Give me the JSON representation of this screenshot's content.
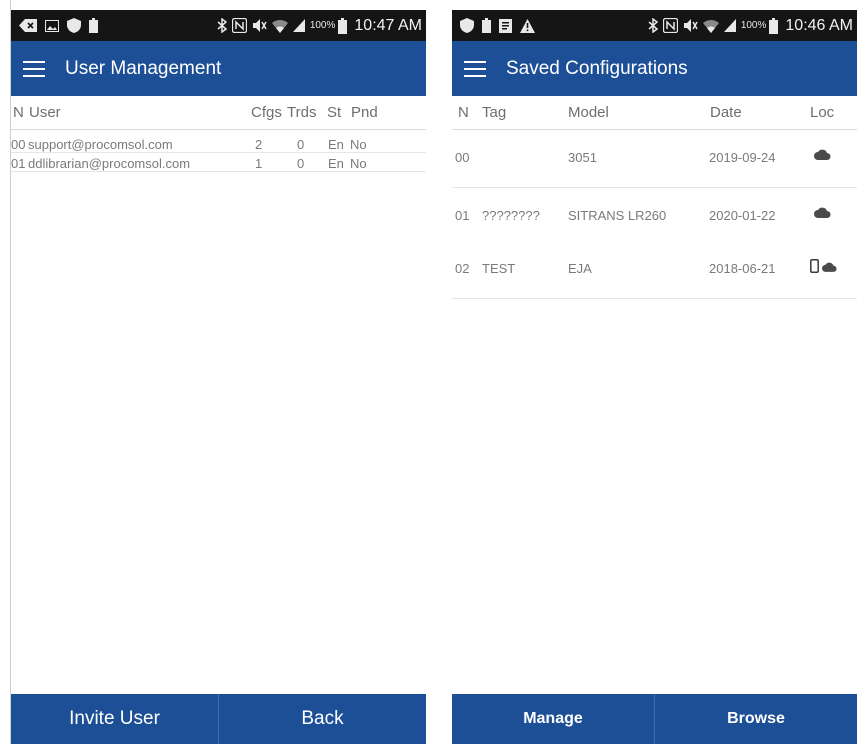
{
  "left_screen": {
    "statusbar": {
      "icons_left": [
        "back-arrow-icon",
        "gallery-icon",
        "shield-icon",
        "battery-small-icon"
      ],
      "icons_right": [
        "bluetooth-icon",
        "nfc-icon",
        "mute-icon",
        "wifi-icon",
        "signal-icon"
      ],
      "battery_text": "100%",
      "time": "10:47 AM"
    },
    "appbar": {
      "title": "User Management"
    },
    "columns": {
      "n": "N",
      "user": "User",
      "cfgs": "Cfgs",
      "trds": "Trds",
      "st": "St",
      "pnd": "Pnd"
    },
    "rows": [
      {
        "n": "00",
        "user": "support@procomsol.com",
        "cfgs": "2",
        "trds": "0",
        "st": "En",
        "pnd": "No"
      },
      {
        "n": "01",
        "user": "ddlibrarian@procomsol.com",
        "cfgs": "1",
        "trds": "0",
        "st": "En",
        "pnd": "No"
      }
    ],
    "footer": {
      "invite_label": "Invite User",
      "back_label": "Back"
    }
  },
  "right_screen": {
    "statusbar": {
      "icons_left": [
        "shield-icon",
        "battery-small-icon",
        "clipboard-icon",
        "warning-icon"
      ],
      "icons_right": [
        "bluetooth-icon",
        "nfc-icon",
        "mute-icon",
        "wifi-icon",
        "signal-icon"
      ],
      "battery_text": "100%",
      "time": "10:46 AM"
    },
    "appbar": {
      "title": "Saved Configurations"
    },
    "columns": {
      "n": "N",
      "tag": "Tag",
      "model": "Model",
      "date": "Date",
      "loc": "Loc"
    },
    "rows": [
      {
        "n": "00",
        "tag": "",
        "model": "3051",
        "date": "2019-09-24",
        "loc": [
          "cloud-icon"
        ]
      },
      {
        "n": "01",
        "tag": "????????",
        "model": "SITRANS LR260",
        "date": "2020-01-22",
        "loc": [
          "cloud-icon"
        ]
      },
      {
        "n": "02",
        "tag": "TEST",
        "model": "EJA",
        "date": "2018-06-21",
        "loc": [
          "phone-icon",
          "cloud-icon"
        ]
      }
    ],
    "footer": {
      "manage_label": "Manage",
      "browse_label": "Browse"
    }
  },
  "colors": {
    "appbar_blue": "#1d4f97",
    "statusbar_black": "#151515",
    "row_text": "#7a7a7a",
    "header_text": "#6f6f6f"
  }
}
